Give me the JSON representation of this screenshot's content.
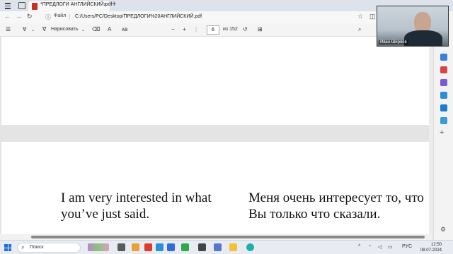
{
  "browser": {
    "tab": {
      "title": "*ПРЕДЛОГИ АНГЛИЙСКИЙ.pdf",
      "close": "×"
    },
    "new_tab": "+",
    "address": {
      "file_label": "Файл",
      "url": "C:/Users/PC/Desktop/ПРЕДЛОГИ%20АНГЛИЙСКИЙ.pdf"
    },
    "nav": {
      "back": "←",
      "forward": "→",
      "refresh": "↻"
    }
  },
  "pdf_toolbar": {
    "draw_label": "Нарисовать",
    "text_tool": "A",
    "zoom_out": "−",
    "zoom_in": "+",
    "page_current": "6",
    "page_total": "из 152"
  },
  "document": {
    "english": "I am very interested in what you’ve just said.",
    "russian": "Меня очень интересует то, что Вы только что сказали."
  },
  "webcam": {
    "name": "Иван Ширяев"
  },
  "taskbar": {
    "search_placeholder": "Поиск",
    "language": "РУС",
    "time": "12:50",
    "date": "08.07.2024"
  }
}
